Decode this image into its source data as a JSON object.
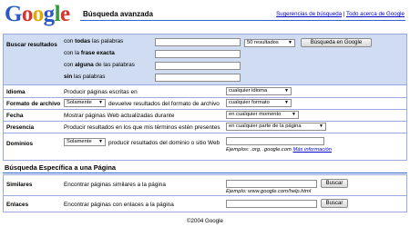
{
  "header": {
    "logo": [
      "G",
      "o",
      "o",
      "g",
      "l",
      "e"
    ],
    "title": "Búsqueda avanzada",
    "link_tips": "Sugerencias de búsqueda",
    "link_about": "Todo acerca de Google",
    "link_sep": " | "
  },
  "find": {
    "label": "Buscar resultados",
    "rows": [
      {
        "pre": "con ",
        "bold": "todas",
        "post": " las palabras"
      },
      {
        "pre": "con la ",
        "bold": "frase exacta",
        "post": ""
      },
      {
        "pre": "con ",
        "bold": "alguna",
        "post": " de las palabras"
      },
      {
        "pre": "",
        "bold": "sin",
        "post": " las palabras"
      }
    ],
    "results_select": "50 resultados",
    "search_button": "Búsqueda en Google"
  },
  "options": {
    "language": {
      "label": "Idioma",
      "text": "Producir páginas escritas en",
      "select": "cualquier idioma"
    },
    "format": {
      "label": "Formato de archivo",
      "mode": "Solamente",
      "text": "devuelve resultados del formato de archivo",
      "select": "cualquier formato"
    },
    "date": {
      "label": "Fecha",
      "text": "Mostrar páginas Web actualizadas durante",
      "select": "en cualquier momento"
    },
    "occurrence": {
      "label": "Presencia",
      "text": "Producir resultados en los que mis términos estén presentes",
      "select": "en cualquier parte de la página"
    },
    "domain": {
      "label": "Dominios",
      "mode": "Solamente",
      "text": "producir resultados del dominio o sitio Web",
      "example": "Ejemplos: .org, .google.com",
      "more": "Más información"
    }
  },
  "page_specific": {
    "title": "Búsqueda Específica a una Página",
    "similar": {
      "label": "Similares",
      "text": "Encontrar páginas similares a la página",
      "button": "Buscar",
      "example": "Ejemplo: www.google.com/help.html"
    },
    "links": {
      "label": "Enlaces",
      "text": "Encontrar páginas con enlaces a la página",
      "button": "Buscar"
    }
  },
  "footer": "©2004 Google",
  "icons": {
    "dropdown": "chevron-down-icon"
  },
  "colors": {
    "band": "#cfdcf2",
    "border": "#99aadd",
    "link": "#0000cc",
    "rule": "#3366cc"
  }
}
